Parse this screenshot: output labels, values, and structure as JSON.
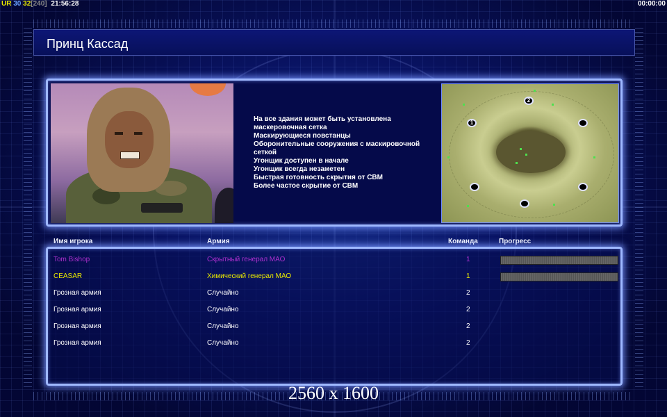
{
  "top_bar": {
    "fps_label": "UR",
    "fps_value_1": "30",
    "fps_value_2": "32",
    "fps_bracket": "[240]",
    "clock": "21:56:28",
    "timer": "00:00:00"
  },
  "screen": {
    "title": "Принц Кассад"
  },
  "general_traits": [
    "На все здания может быть установлена",
    " маскеровочная сетка",
    "Маскирующиеся повстанцы",
    "Оборонительные сооружения с маскировочной",
    " сеткой",
    "Угонщик доступен в начале",
    "Угонщик всегда незаметен",
    "Быстрая готовность скрытия от СВМ",
    "Более частое скрытие от СВМ"
  ],
  "minimap": {
    "start_positions": [
      "1",
      "2"
    ]
  },
  "players_table": {
    "headers": {
      "name": "Имя игрока",
      "army": "Армия",
      "team": "Команда",
      "progress": "Прогресс"
    },
    "rows": [
      {
        "name": "Tom Bishop",
        "army": "Скрытный генерал МАО",
        "team": "1",
        "color": "#b030d0",
        "progress": 1.0
      },
      {
        "name": "CEASAR",
        "army": "Химический генерал МАО",
        "team": "1",
        "color": "#e8e800",
        "progress": 1.0
      },
      {
        "name": "Грозная армия",
        "army": "Случайно",
        "team": "2",
        "color": "#ffffff"
      },
      {
        "name": "Грозная армия",
        "army": "Случайно",
        "team": "2",
        "color": "#ffffff"
      },
      {
        "name": "Грозная армия",
        "army": "Случайно",
        "team": "2",
        "color": "#ffffff"
      },
      {
        "name": "Грозная армия",
        "army": "Случайно",
        "team": "2",
        "color": "#ffffff"
      }
    ]
  },
  "resolution_label": "2560 x 1600",
  "colors": {
    "accent_border": "#9fb8ff",
    "background": "#07104f"
  }
}
